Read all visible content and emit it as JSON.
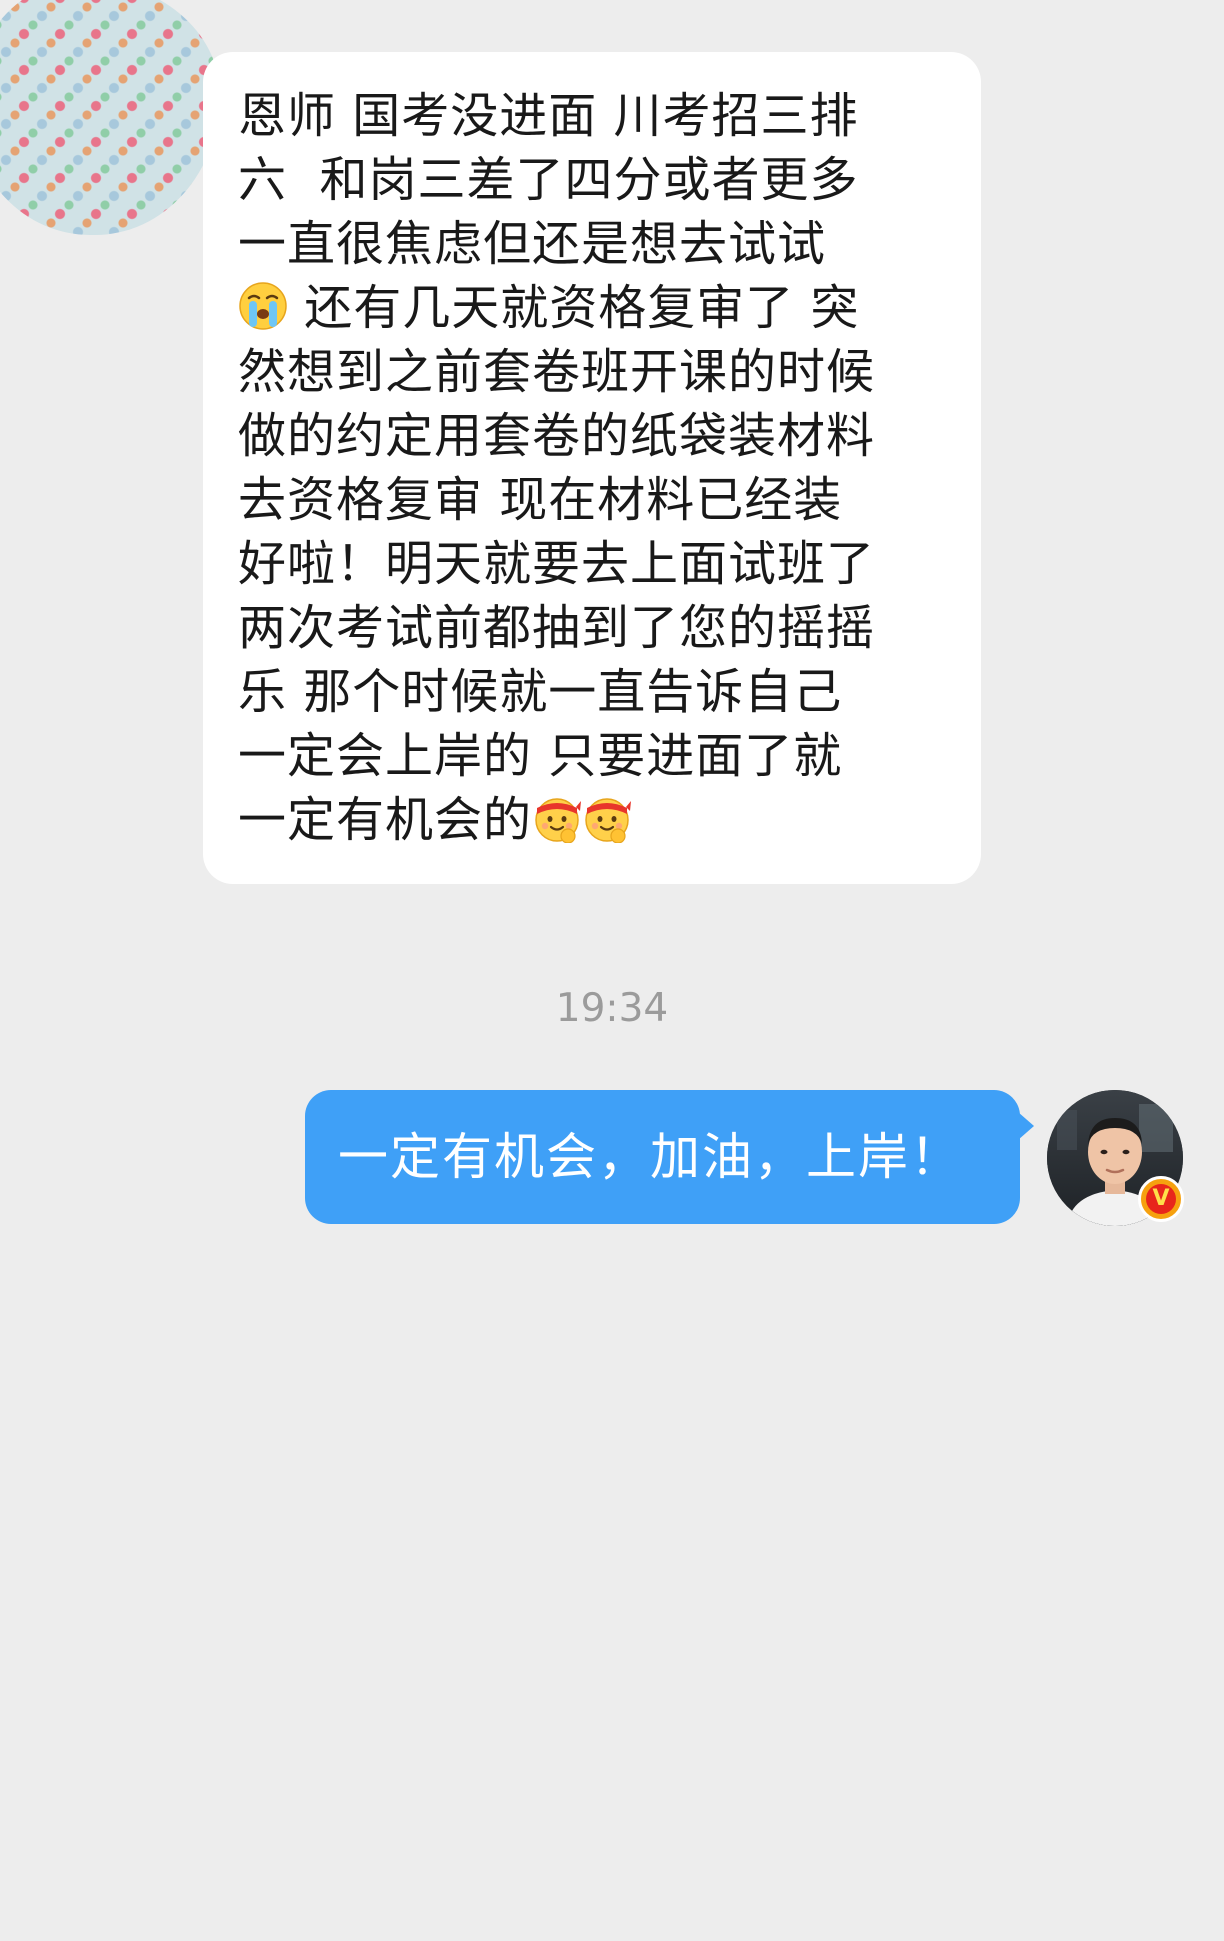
{
  "messages": {
    "incoming": {
      "text_lines": [
        "恩师 国考没进面 川考招三排",
        "六  和岗三差了四分或者更多",
        "一直很焦虑但还是想去试试"
      ],
      "line4_text": " 还有几天就资格复审了 突",
      "text_lines_2": [
        "然想到之前套卷班开课的时候",
        "做的约定用套卷的纸袋装材料",
        "去资格复审 现在材料已经装",
        "好啦！明天就要去上面试班了",
        "两次考试前都抽到了您的摇摇",
        "乐 那个时候就一直告诉自己",
        "一定会上岸的 只要进面了就"
      ],
      "last_line_text": "一定有机会的",
      "emojis": [
        "crying-emoji",
        "fighting-emoji",
        "fighting-emoji"
      ]
    },
    "timestamp": "19:34",
    "outgoing": {
      "text": "一定有机会，加油，上岸！"
    }
  },
  "colors": {
    "background": "#ededed",
    "incoming_bubble": "#ffffff",
    "outgoing_bubble": "#3fa0f7",
    "timestamp": "#9b9b9b",
    "verified_badge": "#f6a10f"
  },
  "badge": {
    "label": "V"
  }
}
